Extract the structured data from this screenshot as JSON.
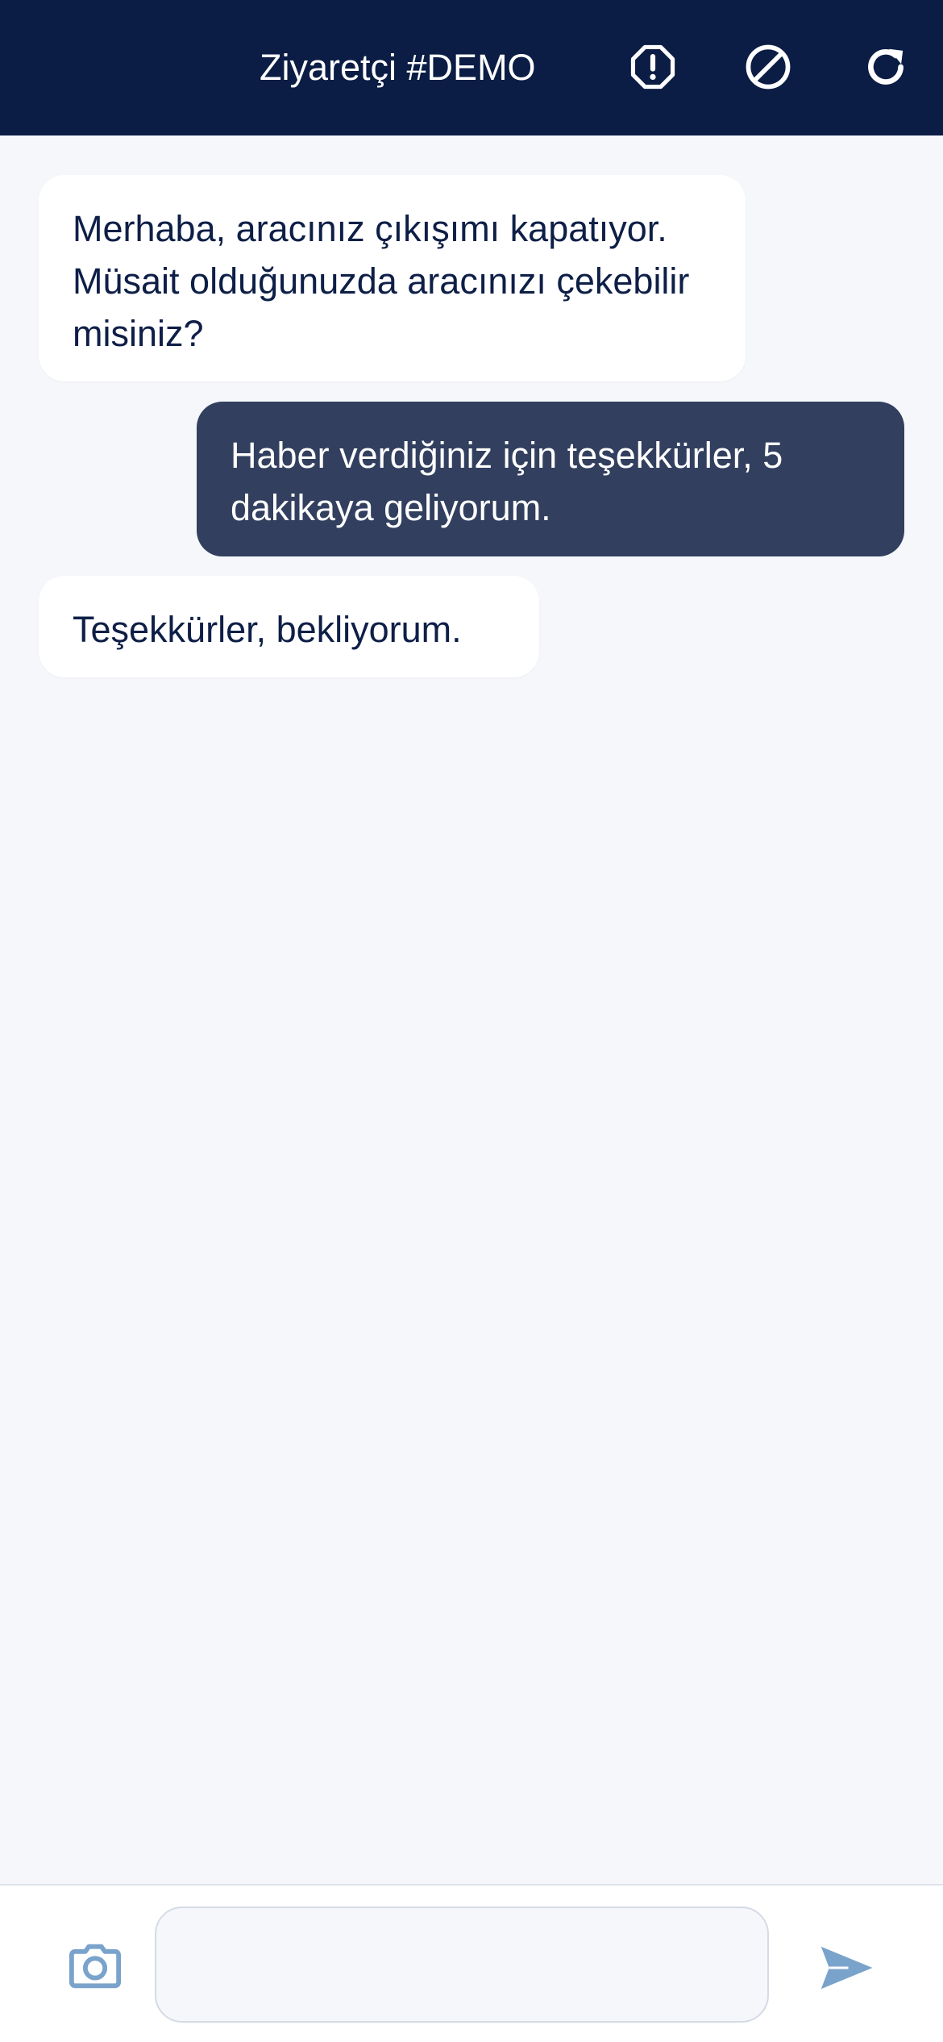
{
  "header": {
    "title": "Ziyaretçi #DEMO",
    "actions": [
      {
        "icon": "report-octagon-icon"
      },
      {
        "icon": "block-icon"
      },
      {
        "icon": "refresh-icon"
      }
    ],
    "background": "#0b1d45"
  },
  "messages": [
    {
      "direction": "incoming",
      "text": "Merhaba, aracınız çıkışımı kapatıyor. Müsait olduğunuzda aracınızı çekebilir misiniz?"
    },
    {
      "direction": "outgoing",
      "text": "Haber verdiğiniz için teşekkürler, 5 dakikaya geliyorum."
    },
    {
      "direction": "incoming",
      "text": "Teşekkürler, bekliyorum."
    }
  ],
  "composer": {
    "input_value": "",
    "placeholder": "",
    "camera_icon": "camera-icon",
    "send_icon": "send-icon"
  },
  "colors": {
    "page_bg": "#f5f7fb",
    "incoming_bubble": "#ffffff",
    "outgoing_bubble": "#323f5f",
    "accent_icon": "#7aa3cc"
  }
}
